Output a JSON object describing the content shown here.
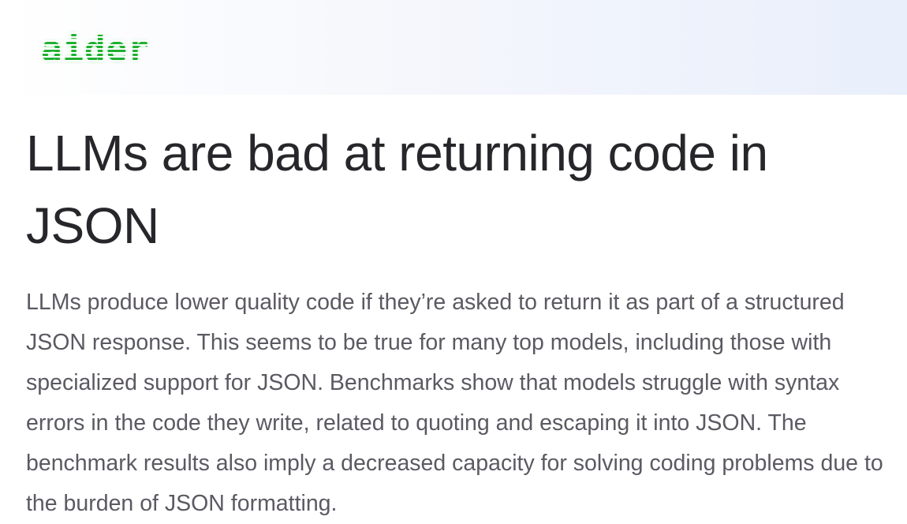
{
  "header": {
    "logo_text": "aider"
  },
  "article": {
    "title": "LLMs are bad at returning code in JSON",
    "summary": "LLMs produce lower quality code if they’re asked to return it as part of a structured JSON response. This seems to be true for many top models, including those with specialized support for JSON. Benchmarks show that models struggle with syntax errors in the code they write, related to quoting and escaping it into JSON. The benchmark results also imply a decreased capacity for solving coding problems due to the burden of JSON formatting."
  },
  "colors": {
    "logo_green": "#1fb02f",
    "title_text": "#27262b",
    "body_text": "#5c5962",
    "header_gradient_end": "#e9effb"
  }
}
